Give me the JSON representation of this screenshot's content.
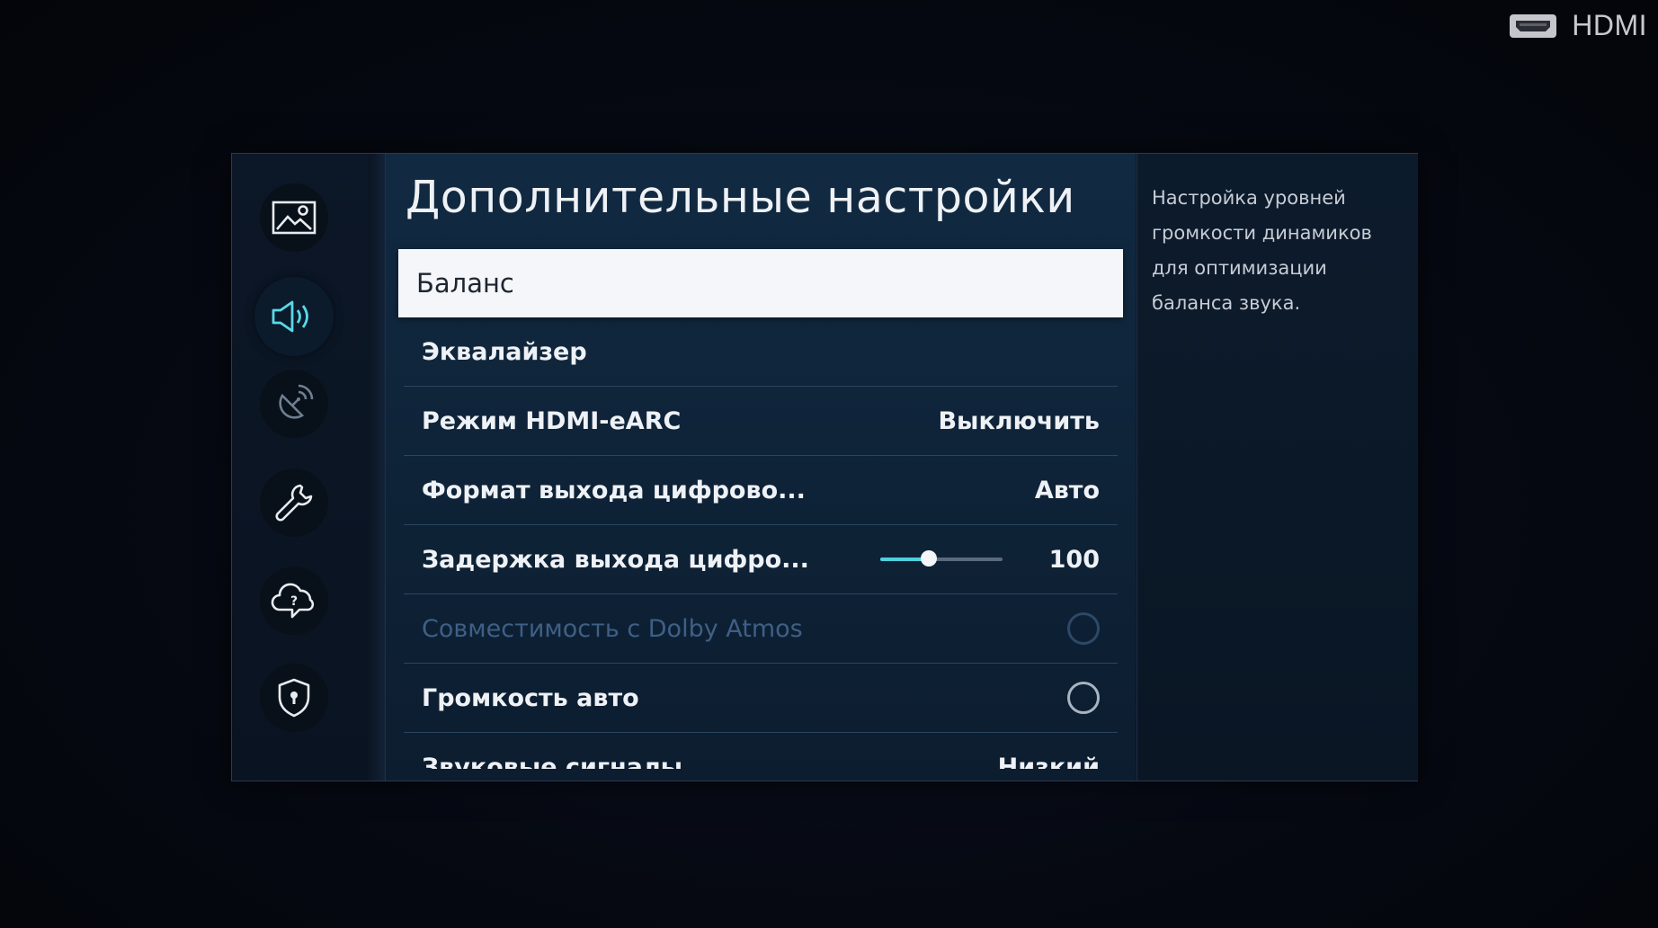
{
  "source": {
    "label": "HDMI",
    "icon": "hdmi-port-icon"
  },
  "sidebar": {
    "items": [
      {
        "name": "picture",
        "icon": "picture-icon",
        "active": false
      },
      {
        "name": "sound",
        "icon": "speaker-icon",
        "active": true
      },
      {
        "name": "broadcasting",
        "icon": "satellite-dish-icon",
        "active": false
      },
      {
        "name": "general",
        "icon": "wrench-icon",
        "active": false
      },
      {
        "name": "support",
        "icon": "cloud-question-icon",
        "active": false
      },
      {
        "name": "privacy",
        "icon": "shield-icon",
        "active": false
      }
    ]
  },
  "menu": {
    "title": "Дополнительные настройки",
    "items": [
      {
        "label": "Баланс",
        "focused": true
      },
      {
        "label": "Эквалайзер"
      },
      {
        "label": "Режим HDMI-eARC",
        "value": "Выключить"
      },
      {
        "label": "Формат выхода цифрово...",
        "value": "Авто"
      },
      {
        "label": "Задержка выхода цифро...",
        "value": "100",
        "slider_fraction": 0.4
      },
      {
        "label": "Совместимость с Dolby Atmos",
        "toggle": false,
        "disabled": true
      },
      {
        "label": "Громкость авто",
        "toggle": false
      },
      {
        "label": "Звуковые сигналы",
        "value": "Низкий"
      }
    ]
  },
  "description": {
    "text": "Настройка уровней громкости динамиков для оптимизации баланса звука."
  },
  "colors": {
    "accent": "#4fd0e0",
    "focus_bg": "#f4f6f9",
    "disabled_text": "#3f5f86"
  }
}
